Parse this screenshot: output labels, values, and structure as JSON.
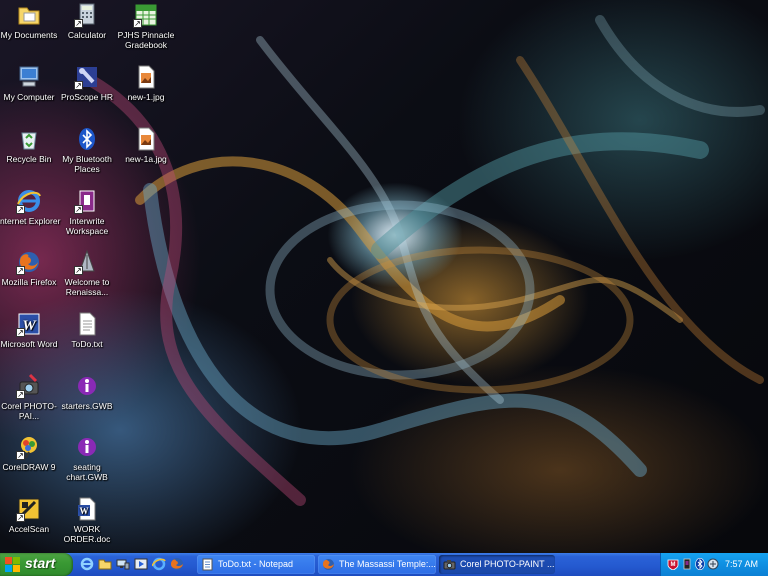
{
  "desktop": {
    "icons": [
      {
        "label": "My Documents",
        "icon": "folder-documents-icon"
      },
      {
        "label": "Calculator",
        "icon": "calculator-icon"
      },
      {
        "label": "PJHS Pinnacle Gradebook",
        "icon": "gradebook-icon"
      },
      {
        "label": "My Computer",
        "icon": "computer-icon"
      },
      {
        "label": "ProScope HR",
        "icon": "proscope-icon"
      },
      {
        "label": "new-1.jpg",
        "icon": "jpg-file-icon"
      },
      {
        "label": "Recycle Bin",
        "icon": "recycle-bin-icon"
      },
      {
        "label": "My Bluetooth Places",
        "icon": "bluetooth-icon"
      },
      {
        "label": "new-1a.jpg",
        "icon": "jpg-file-icon"
      },
      {
        "label": "Internet Explorer",
        "icon": "internet-explorer-icon"
      },
      {
        "label": "Interwrite Workspace",
        "icon": "interwrite-icon"
      },
      {
        "label": "Mozilla Firefox",
        "icon": "firefox-icon"
      },
      {
        "label": "Welcome to Renaissa...",
        "icon": "renaissance-icon"
      },
      {
        "label": "Microsoft Word",
        "icon": "word-icon"
      },
      {
        "label": "ToDo.txt",
        "icon": "text-file-icon"
      },
      {
        "label": "Corel PHOTO-PAI...",
        "icon": "corel-photo-paint-icon"
      },
      {
        "label": "starters.GWB",
        "icon": "gwb-file-icon"
      },
      {
        "label": "CorelDRAW 9",
        "icon": "coreldraw-icon"
      },
      {
        "label": "seating chart.GWB",
        "icon": "gwb-file-icon"
      },
      {
        "label": "AccelScan",
        "icon": "accelscan-icon"
      },
      {
        "label": "WORK ORDER.doc",
        "icon": "word-doc-icon"
      }
    ]
  },
  "taskbar": {
    "start_label": "start",
    "quick_launch": [
      "internet-explorer-icon",
      "folder-icon",
      "network-icon",
      "media-icon",
      "ie-icon",
      "firefox-icon"
    ],
    "tasks": [
      {
        "label": "ToDo.txt - Notepad",
        "icon": "notepad-icon",
        "active": false
      },
      {
        "label": "The Massassi Temple:...",
        "icon": "firefox-icon",
        "active": false
      },
      {
        "label": "Corel PHOTO-PAINT ...",
        "icon": "corel-photo-paint-icon",
        "active": true
      }
    ],
    "tray": {
      "icons": [
        "mcafee-icon",
        "app-icon",
        "bluetooth-icon",
        "network-icon"
      ],
      "clock": "7:57 AM"
    }
  },
  "colors": {
    "taskbar_blue": "#2459cf",
    "start_green": "#3a9a34",
    "tray_blue": "#0f8fe2"
  }
}
